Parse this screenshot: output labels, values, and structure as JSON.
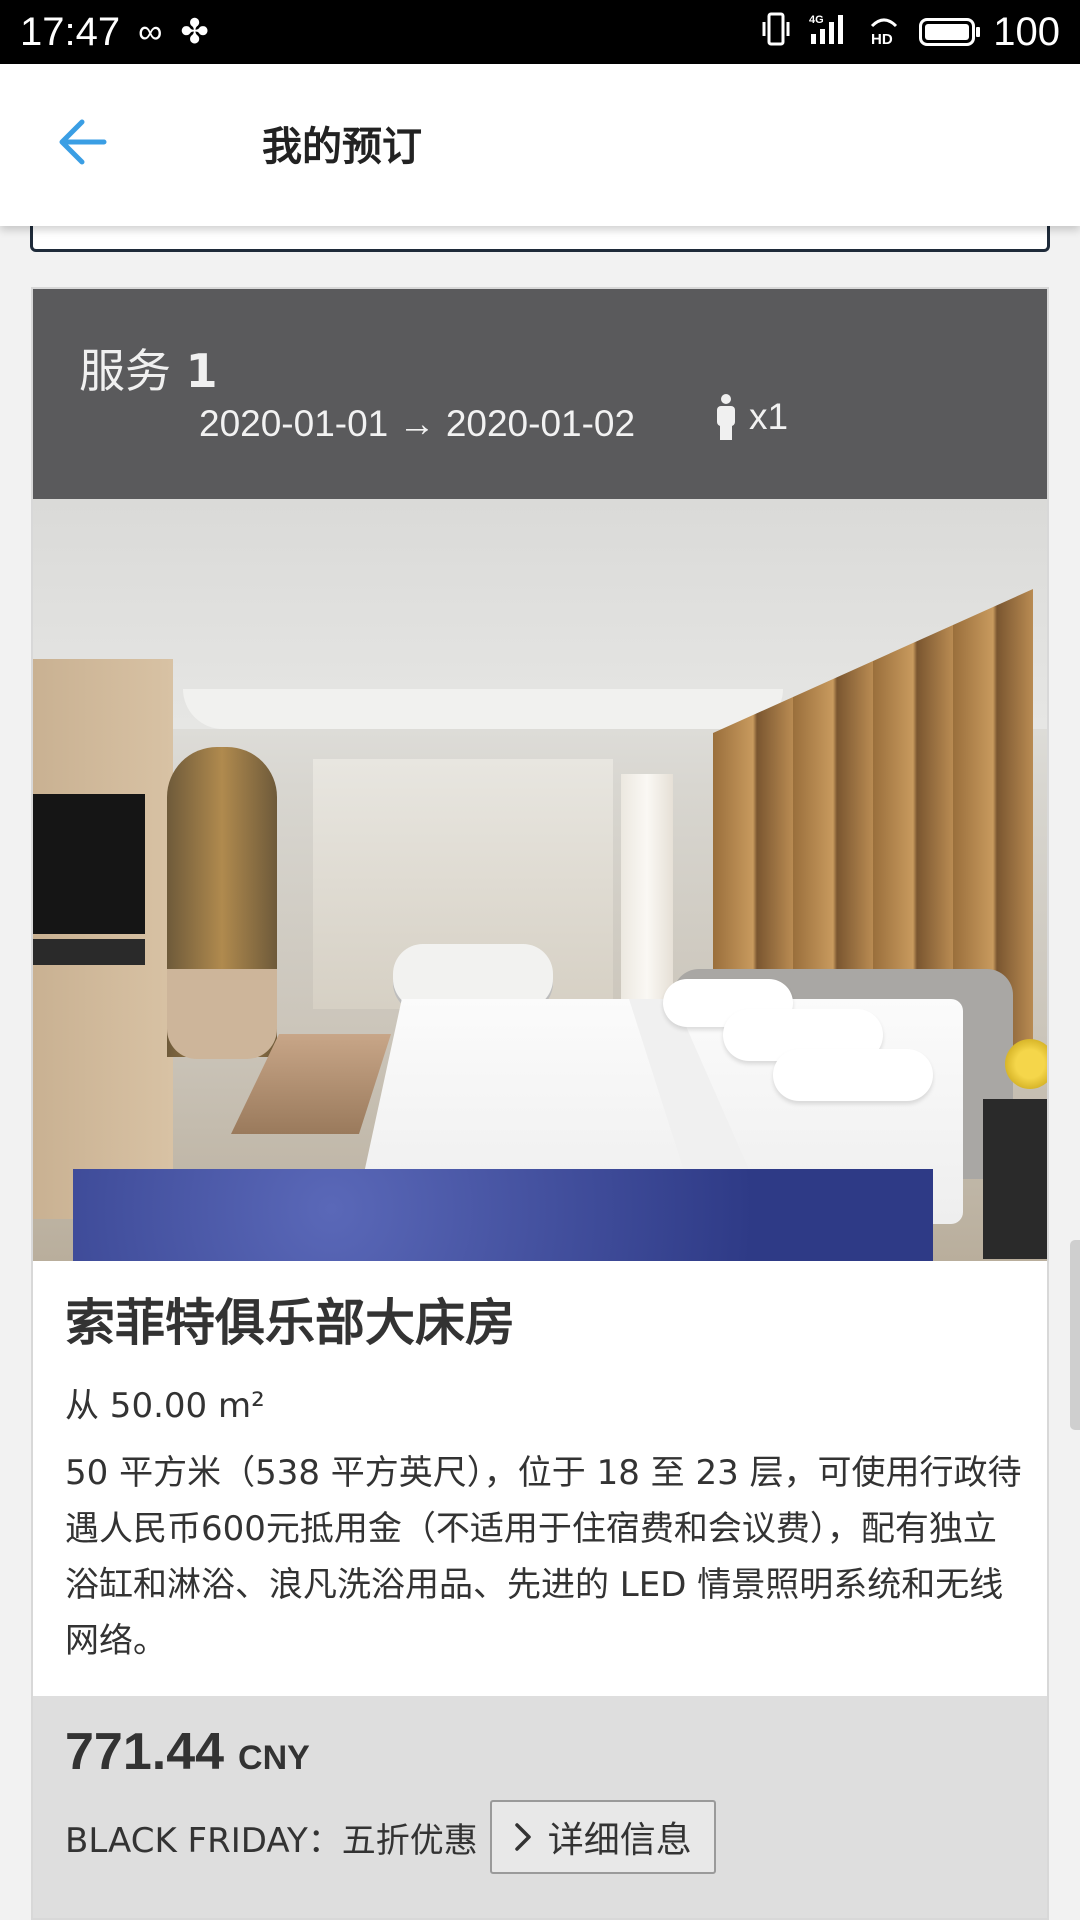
{
  "status_bar": {
    "time": "17:47",
    "battery": "100",
    "icons": [
      "infinity-icon",
      "pinwheel-icon",
      "vibrate-icon",
      "signal-4g-icon",
      "hd-icon",
      "battery-icon"
    ]
  },
  "header": {
    "title": "我的预订",
    "back_icon": "arrow-left-icon",
    "accent_color": "#3a9ee4"
  },
  "service": {
    "title_prefix": "服务",
    "number": "1",
    "dates": "2020-01-01 → 2020-01-02",
    "guests": "x1",
    "guest_icon": "person-icon"
  },
  "room": {
    "image_alt": "hotel-room-photo",
    "name": "索菲特俱乐部大床房",
    "size": "从 50.00 m²",
    "description": "50 平方米（538 平方英尺），位于 18 至 23 层，可使用行政待遇人民币600元抵用金（不适用于住宿费和会议费），配有独立浴缸和淋浴、浪凡洗浴用品、先进的 LED 情景照明系统和无线网络。"
  },
  "price": {
    "amount": "771.44",
    "currency": "CNY",
    "promo": "BLACK FRIDAY：五折优惠",
    "details_button": "详细信息",
    "details_icon": "chevron-right-icon"
  }
}
